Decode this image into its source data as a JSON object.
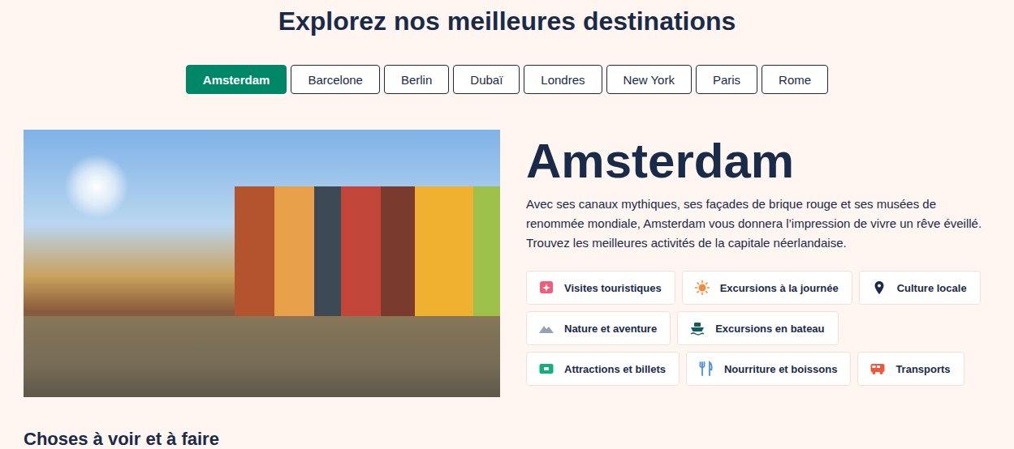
{
  "page": {
    "title": "Explorez nos meilleures destinations"
  },
  "tabs": [
    {
      "label": "Amsterdam",
      "selected": true
    },
    {
      "label": "Barcelone",
      "selected": false
    },
    {
      "label": "Berlin",
      "selected": false
    },
    {
      "label": "Dubaï",
      "selected": false
    },
    {
      "label": "Londres",
      "selected": false
    },
    {
      "label": "New York",
      "selected": false
    },
    {
      "label": "Paris",
      "selected": false
    },
    {
      "label": "Rome",
      "selected": false
    }
  ],
  "destination": {
    "name": "Amsterdam",
    "description": "Avec ses canaux mythiques, ses façades de brique rouge et ses musées de renommée mondiale, Amsterdam vous donnera l’impression de vivre un rêve éveillé. Trouvez les meilleures activités de la capitale néerlandaise."
  },
  "categories": [
    {
      "label": "Visites touristiques",
      "color": "#f25c78"
    },
    {
      "label": "Excursions à la journée",
      "color": "#f78b3c"
    },
    {
      "label": "Culture locale",
      "color": "#1a2b49"
    },
    {
      "label": "Nature et aventure",
      "color": "#9aa3ad"
    },
    {
      "label": "Excursions en bateau",
      "color": "#0e5c66"
    },
    {
      "label": "Attractions et billets",
      "color": "#13b07c"
    },
    {
      "label": "Nourriture et boissons",
      "color": "#4a90e2"
    },
    {
      "label": "Transports",
      "color": "#f0563a"
    }
  ],
  "section": {
    "title": "Choses à voir et à faire"
  }
}
